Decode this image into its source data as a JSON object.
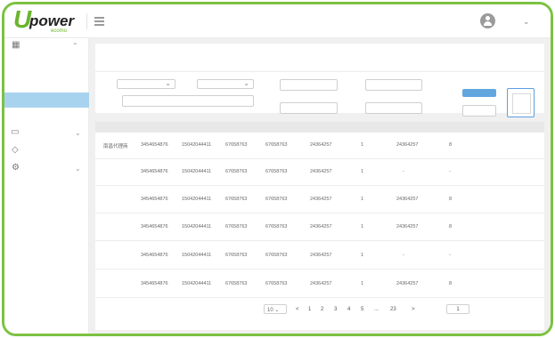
{
  "brand": {
    "letter": "U",
    "name": "power",
    "sub": "ecomo"
  },
  "table": {
    "rows": [
      {
        "name": "南昌代理商",
        "c1": "3454654876",
        "c2": "15042044411",
        "c3": "67658763",
        "c4": "67658763",
        "c5": "24364257",
        "c6": "1",
        "c7": "24364257",
        "c8": "8"
      },
      {
        "name": "",
        "c1": "3454654876",
        "c2": "15042044411",
        "c3": "67658763",
        "c4": "67658763",
        "c5": "24364257",
        "c6": "1",
        "c7": "-",
        "c8": "-"
      },
      {
        "name": "",
        "c1": "3454654876",
        "c2": "15042044411",
        "c3": "67658763",
        "c4": "67658763",
        "c5": "24364257",
        "c6": "1",
        "c7": "24364257",
        "c8": "8"
      },
      {
        "name": "",
        "c1": "3454654876",
        "c2": "15042044411",
        "c3": "67658763",
        "c4": "67658763",
        "c5": "24364257",
        "c6": "1",
        "c7": "24364257",
        "c8": "8"
      },
      {
        "name": "",
        "c1": "3454654876",
        "c2": "15042044411",
        "c3": "67658763",
        "c4": "67658763",
        "c5": "24364257",
        "c6": "1",
        "c7": "-",
        "c8": "-"
      },
      {
        "name": "",
        "c1": "3454654876",
        "c2": "15042044411",
        "c3": "67658763",
        "c4": "67658763",
        "c5": "24364257",
        "c6": "1",
        "c7": "24364257",
        "c8": "8"
      }
    ]
  },
  "pagination": {
    "page_size": "10",
    "prev": "<",
    "pages": [
      "1",
      "2",
      "3",
      "4",
      "5"
    ],
    "ellipsis": "...",
    "last": "23",
    "next": ">",
    "goto_value": "1"
  },
  "icons": {
    "menu": "hamburger-icon",
    "avatar": "user-avatar-icon",
    "sidebar": [
      "grid-icon",
      "card-icon",
      "chart-icon",
      "gear-icon"
    ]
  },
  "colors": {
    "brand_green": "#7cc242",
    "primary_blue": "#62a6e0",
    "active_menu": "#a8d3ee"
  }
}
